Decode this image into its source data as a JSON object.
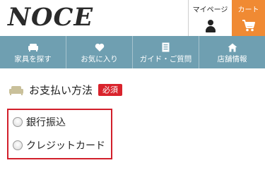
{
  "header": {
    "logo": "NOCE",
    "mypage_label": "マイページ",
    "cart_label": "カート"
  },
  "nav": {
    "items": [
      {
        "label": "家具を探す",
        "icon": "sofa-icon"
      },
      {
        "label": "お気に入り",
        "icon": "heart-icon"
      },
      {
        "label": "ガイド・ご質問",
        "icon": "document-icon"
      },
      {
        "label": "店舗情報",
        "icon": "store-icon"
      }
    ]
  },
  "section": {
    "title": "お支払い方法",
    "required_badge": "必須"
  },
  "payment": {
    "options": [
      {
        "label": "銀行振込",
        "selected": false
      },
      {
        "label": "クレジットカード",
        "selected": false
      }
    ]
  },
  "colors": {
    "nav_bg": "#6f9fb1",
    "cart_bg": "#f08a33",
    "badge_bg": "#d9232c",
    "highlight_border": "#d21f2b"
  }
}
